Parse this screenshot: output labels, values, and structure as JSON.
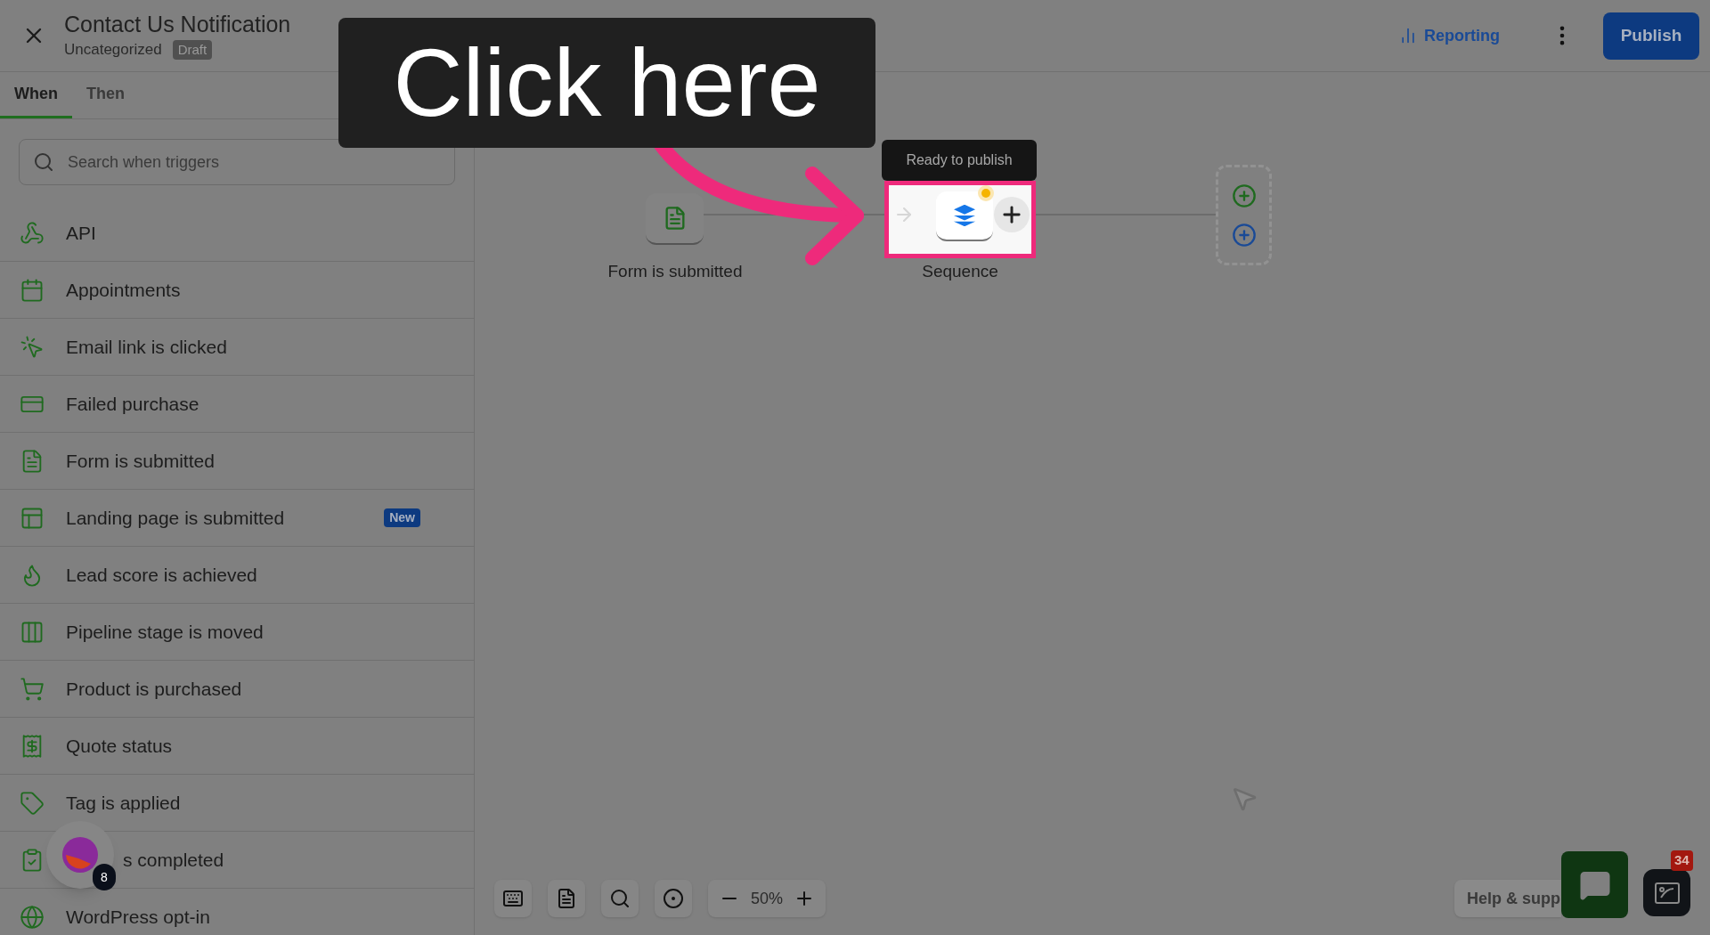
{
  "header": {
    "title": "Contact Us Notification",
    "category": "Uncategorized",
    "status_badge": "Draft",
    "reporting": "Reporting",
    "publish": "Publish"
  },
  "callout": {
    "text": "Click here"
  },
  "sidebar": {
    "tabs": [
      {
        "label": "When",
        "selected": true
      },
      {
        "label": "Then",
        "selected": false
      }
    ],
    "search": {
      "placeholder": "Search when triggers"
    },
    "items": [
      {
        "label": "API"
      },
      {
        "label": "Appointments"
      },
      {
        "label": "Email link is clicked"
      },
      {
        "label": "Failed purchase"
      },
      {
        "label": "Form is submitted"
      },
      {
        "label": "Landing page is submitted",
        "badge": "New"
      },
      {
        "label": "Lead score is achieved"
      },
      {
        "label": "Pipeline stage is moved"
      },
      {
        "label": "Product is purchased"
      },
      {
        "label": "Quote status"
      },
      {
        "label": "Tag is applied"
      },
      {
        "label": "s completed",
        "covered": true
      },
      {
        "label": "WordPress opt-in"
      }
    ]
  },
  "canvas": {
    "nodes": [
      {
        "label": "Form is submitted",
        "highlighted": false
      },
      {
        "label": "Sequence",
        "highlighted": true,
        "tooltip": "Ready to publish"
      }
    ]
  },
  "zoom": {
    "reading": "50%"
  },
  "help": {
    "label": "Help & supp"
  },
  "avatar": {
    "badge": "8"
  },
  "apps": {
    "badge": "34"
  }
}
